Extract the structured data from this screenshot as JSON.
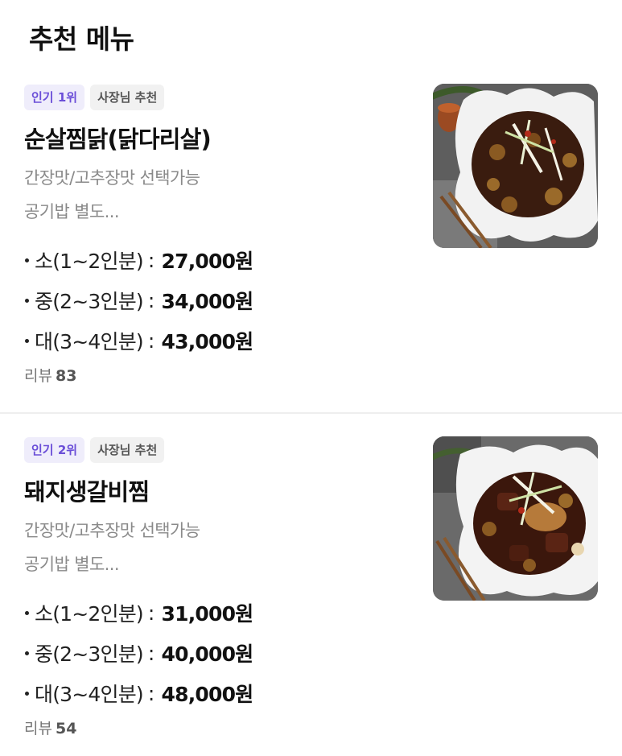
{
  "page": {
    "title": "추천 메뉴"
  },
  "items": [
    {
      "rank_badge": "인기 1위",
      "owner_badge": "사장님 추천",
      "name": "순살찜닭(닭다리살)",
      "desc_line1": "간장맛/고추장맛  선택가능",
      "desc_line2": "공기밥 별도...",
      "prices": [
        {
          "size": "소(1~2인분)",
          "price": "27,000원"
        },
        {
          "size": "중(2~3인분)",
          "price": "34,000원"
        },
        {
          "size": "대(3~4인분)",
          "price": "43,000원"
        }
      ],
      "review_label": "리뷰",
      "review_count": "83",
      "image_icon": "braised-chicken-photo"
    },
    {
      "rank_badge": "인기 2위",
      "owner_badge": "사장님 추천",
      "name": "돼지생갈비찜",
      "desc_line1": "간장맛/고추장맛  선택가능",
      "desc_line2": "공기밥 별도...",
      "prices": [
        {
          "size": "소(1~2인분)",
          "price": "31,000원"
        },
        {
          "size": "중(2~3인분)",
          "price": "40,000원"
        },
        {
          "size": "대(3~4인분)",
          "price": "48,000원"
        }
      ],
      "review_label": "리뷰",
      "review_count": "54",
      "image_icon": "braised-pork-rib-photo"
    }
  ],
  "colors": {
    "rank_badge_text": "#6b4fd8",
    "rank_badge_bg": "#efedfb",
    "owner_badge_bg": "#f1f1f1",
    "muted_text": "#8a8a8a"
  }
}
